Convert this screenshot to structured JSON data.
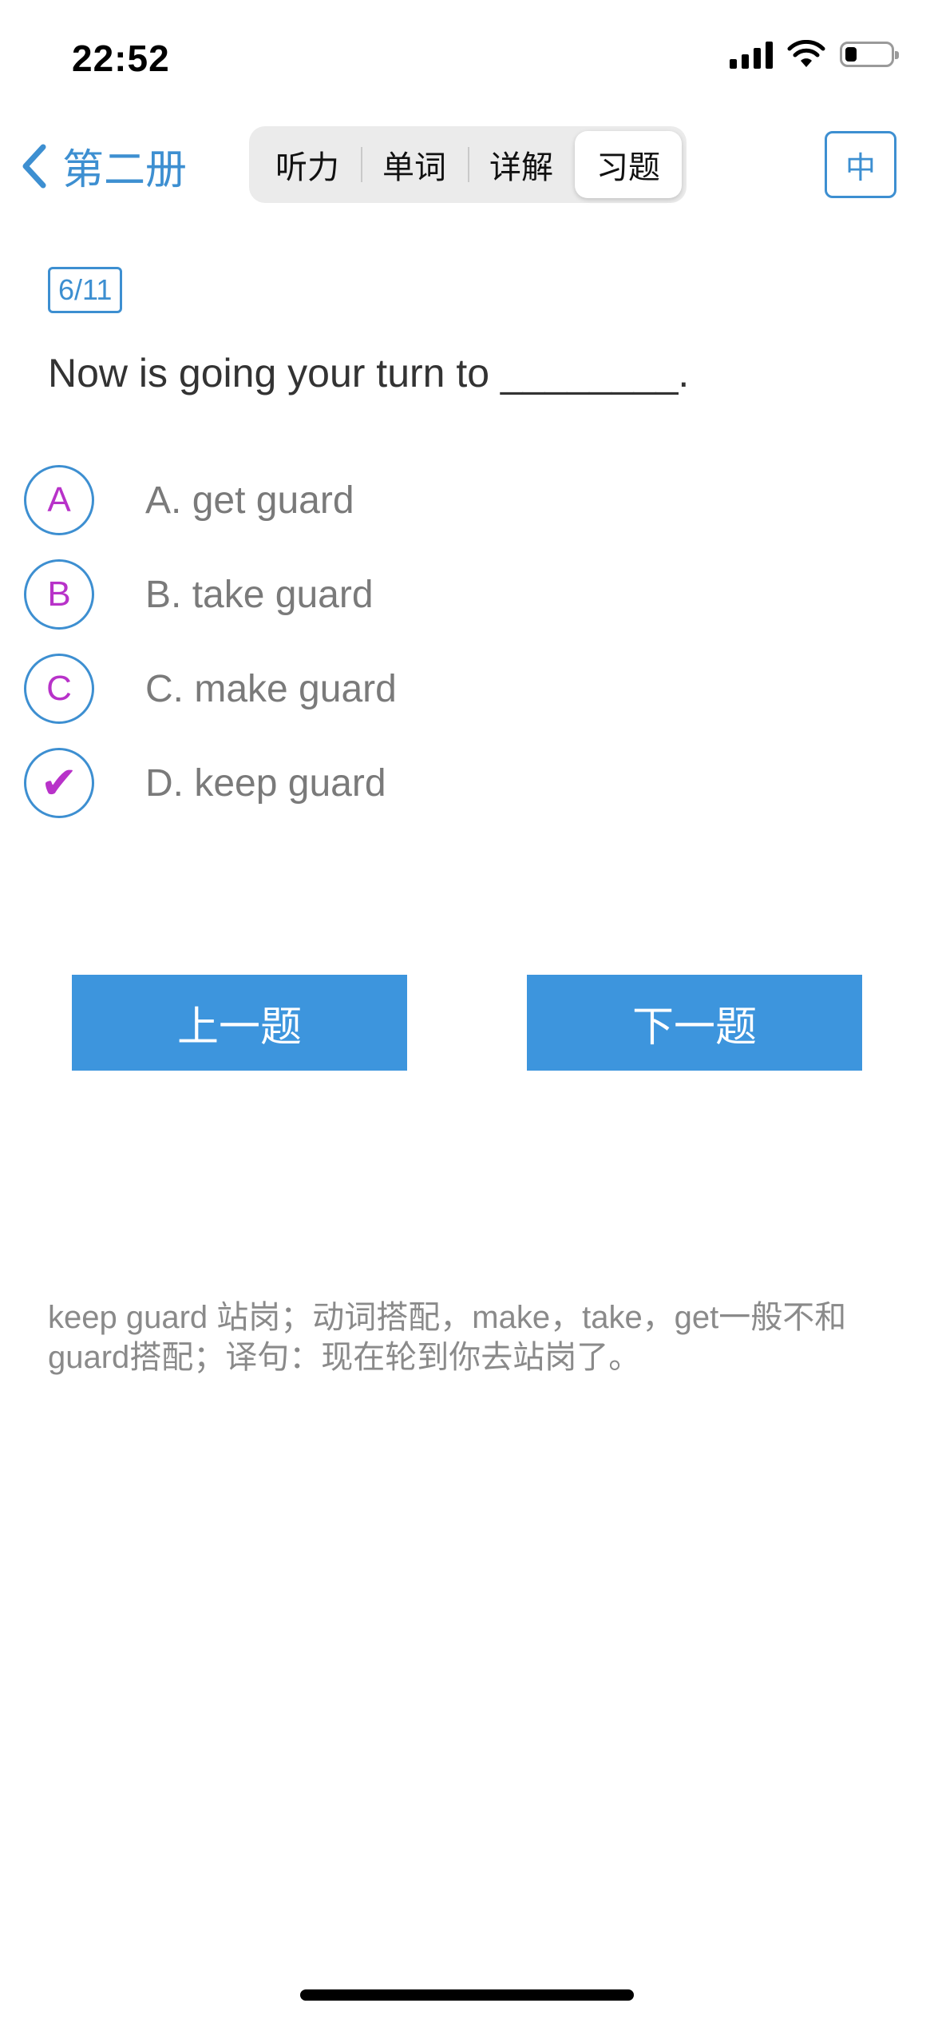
{
  "status_bar": {
    "time": "22:52",
    "battery_level": 0.25
  },
  "nav": {
    "back_label": "第二册",
    "tabs": [
      {
        "label": "听力",
        "active": false
      },
      {
        "label": "单词",
        "active": false
      },
      {
        "label": "详解",
        "active": false
      },
      {
        "label": "习题",
        "active": true
      }
    ],
    "lang_label": "中"
  },
  "question": {
    "counter": "6/11",
    "text": "Now is going your turn to ________.",
    "options": [
      {
        "marker": "A",
        "text": "A. get guard",
        "selected": false
      },
      {
        "marker": "B",
        "text": "B. take guard",
        "selected": false
      },
      {
        "marker": "C",
        "text": "C. make guard",
        "selected": false
      },
      {
        "marker": "✔",
        "text": "D. keep guard",
        "selected": true
      }
    ]
  },
  "buttons": {
    "prev_label": "上一题",
    "next_label": "下一题"
  },
  "explanation": "keep guard 站岗；动词搭配，make，take，get一般不和guard搭配；译句：现在轮到你去站岗了。",
  "colors": {
    "accent": "#3d8fd1",
    "button": "#3d95dd",
    "option_marker": "#b832c9",
    "option_text": "#7a7a7a",
    "explanation_text": "#8a8a8a"
  }
}
